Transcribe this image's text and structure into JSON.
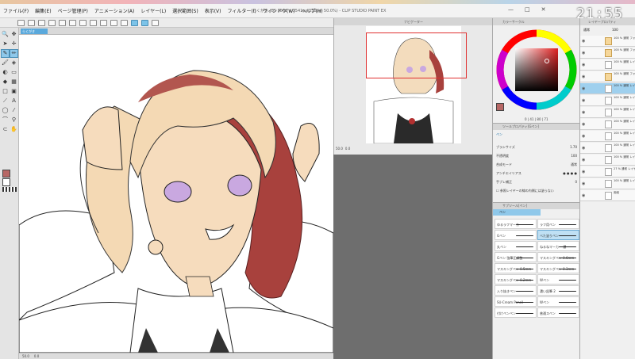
{
  "app": {
    "title": "らくがき (B5 2508 x 3541px 350dpi 50.0%) - CLIP STUDIO PAINT EX",
    "clock": "21:55",
    "window_controls": [
      "—",
      "□",
      "✕"
    ]
  },
  "menu": [
    "ファイル(F)",
    "編集(E)",
    "ページ管理(P)",
    "アニメーション(A)",
    "レイヤー(L)",
    "選択範囲(S)",
    "表示(V)",
    "フィルター(I)",
    "ウィンドウ(W)",
    "ヘルプ(H)"
  ],
  "canvas": {
    "tab_label": "らくがき",
    "status_zoom": "50.0",
    "status_extra": "0.0"
  },
  "navigator": {
    "title": "ナビゲーター",
    "zoom": "50.0",
    "rotation": "0.0"
  },
  "color_wheel": {
    "title": "カラーサークル",
    "main_color": "#b76765",
    "readout": "0  |  41  |  80  |  71"
  },
  "tool_property": {
    "title": "ツールプロパティ[Gペン]",
    "tool_name": "ペン",
    "rows": [
      {
        "label": "ブラシサイズ",
        "value": "1.70"
      },
      {
        "label": "不透明度",
        "value": "100"
      },
      {
        "label": "合成モード",
        "value": "通常"
      },
      {
        "label": "アンチエイリアス",
        "value": ""
      },
      {
        "label": "手ブレ補正",
        "value": "0"
      },
      {
        "label": "参照レイヤーの線の内側には塗らない",
        "value": ""
      }
    ]
  },
  "subtool": {
    "title": "サブツール[ペン]",
    "tab": "ペン",
    "brushes": [
      [
        "ゆるラフマーカー",
        "ラフ用ペン"
      ],
      [
        "Gペン",
        "べた塗りペン"
      ],
      [
        "丸ペン",
        "ねるねマーカー 濃"
      ],
      [
        "Gペン 強筆圧調整",
        "マスキングペン 0.6mm"
      ],
      [
        "マスキングペン 0.5mm",
        "マスキングペン 0.3mm"
      ],
      [
        "マスキングペン 0.2mm",
        "Wペン"
      ],
      [
        "入り抜きペン",
        "濃い鉛筆 2"
      ],
      [
        "SU-Cream Pencil",
        "Wペン"
      ],
      [
        "付けペンペン",
        "普通スペン"
      ]
    ]
  },
  "layers": {
    "title": "レイヤープロパティ",
    "blend": "通常",
    "opacity": "100",
    "items": [
      {
        "name": "100 % 通常 フォルダー",
        "folder": true,
        "sel": false
      },
      {
        "name": "100 % 通常 フォルダー 2",
        "folder": true,
        "sel": false
      },
      {
        "name": "100 % 通常 レイヤー 39",
        "folder": false,
        "sel": false
      },
      {
        "name": "100 % 通常 フォルダー 4",
        "folder": true,
        "sel": false
      },
      {
        "name": "100 % 通常 レイヤー 2",
        "folder": false,
        "sel": true
      },
      {
        "name": "100 % 通常 レイヤー 7",
        "folder": false,
        "sel": false
      },
      {
        "name": "100 % 通常 レイヤー 3",
        "folder": false,
        "sel": false
      },
      {
        "name": "100 % 通常 レイヤー 6",
        "folder": false,
        "sel": false
      },
      {
        "name": "100 % 通常 レイヤー 5",
        "folder": false,
        "sel": false
      },
      {
        "name": "100 % 通常 レイヤー 4",
        "folder": false,
        "sel": false
      },
      {
        "name": "100 % 通常 レイヤー 1",
        "folder": false,
        "sel": false
      },
      {
        "name": "27 % 通常 レイヤー 38",
        "folder": false,
        "sel": false
      },
      {
        "name": "100 % 通常 レイヤー 30",
        "folder": false,
        "sel": false
      },
      {
        "name": "用紙",
        "folder": false,
        "sel": false
      }
    ]
  }
}
